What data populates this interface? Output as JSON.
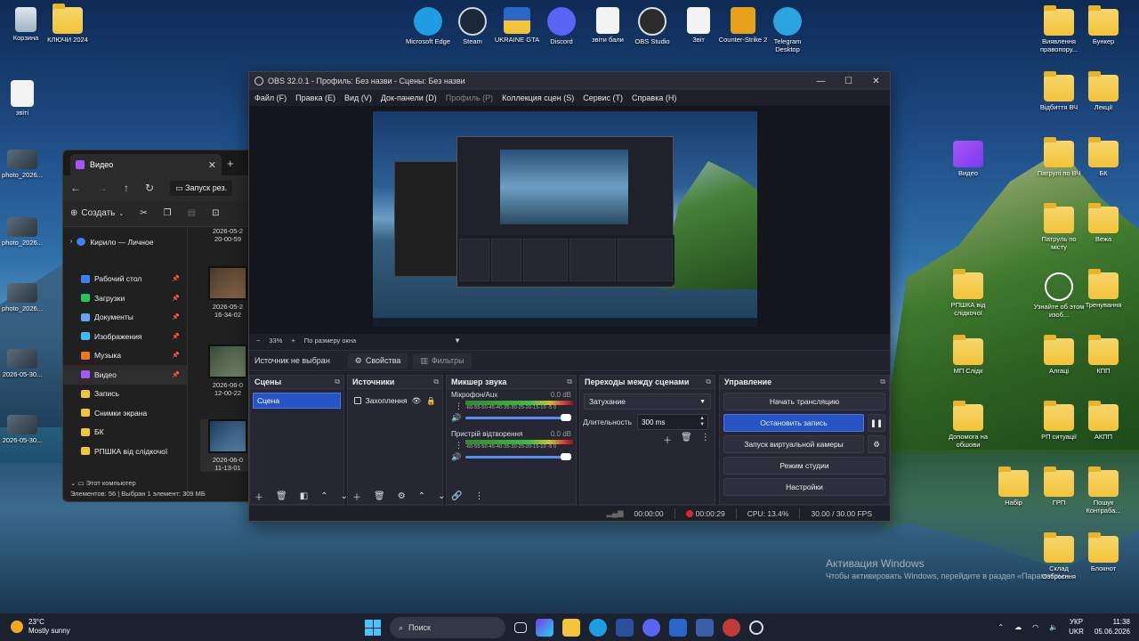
{
  "desktop": {
    "left_icons": [
      {
        "label": "Корзина",
        "icon": "recycle-bin-icon"
      },
      {
        "label": "КЛЮЧИ 2024",
        "icon": "folder-icon"
      },
      {
        "label": "звіті",
        "icon": "document-icon"
      },
      {
        "label": "photo_2026...",
        "icon": "image-icon"
      },
      {
        "label": "photo_2026...",
        "icon": "image-icon"
      },
      {
        "label": "photo_2026...",
        "icon": "image-icon"
      },
      {
        "label": "2026-05-30...",
        "icon": "image-icon"
      },
      {
        "label": "2026-05-30...",
        "icon": "image-icon"
      }
    ],
    "top_icons": [
      {
        "label": "Microsoft Edge",
        "icon": "edge-icon",
        "color": "#1f9de3"
      },
      {
        "label": "Steam",
        "icon": "steam-icon",
        "color": "#1b2838"
      },
      {
        "label": "UKRAINE GTA",
        "icon": "ukraine-gta-icon",
        "color": "#2a66c8"
      },
      {
        "label": "Discord",
        "icon": "discord-icon",
        "color": "#5865f2"
      },
      {
        "label": "звіти бали",
        "icon": "document-icon",
        "color": "#f3f3f3"
      },
      {
        "label": "OBS Studio",
        "icon": "obs-icon",
        "color": "#2b2b2b"
      },
      {
        "label": "Звіт",
        "icon": "document-icon",
        "color": "#f3f3f3"
      },
      {
        "label": "Counter-Strike 2",
        "icon": "counter-strike-icon",
        "color": "#e6a21c"
      },
      {
        "label": "Telegram Desktop",
        "icon": "telegram-icon",
        "color": "#2aa3df"
      }
    ],
    "right_icons": [
      {
        "label": "Виявлення правопору...",
        "icon": "folder-icon"
      },
      {
        "label": "Бункер",
        "icon": "folder-icon"
      },
      {
        "label": "Відбиття ВЧ",
        "icon": "folder-icon"
      },
      {
        "label": "Лекції",
        "icon": "folder-icon"
      },
      {
        "label": "Видео",
        "icon": "video-folder-icon"
      },
      {
        "label": "Патрулі по ВЧ",
        "icon": "folder-icon"
      },
      {
        "label": "БК",
        "icon": "folder-icon"
      },
      {
        "label": "Патруль по місту",
        "icon": "folder-icon"
      },
      {
        "label": "Вежа",
        "icon": "folder-icon"
      },
      {
        "label": "РПШКА від слідкочої",
        "icon": "folder-icon"
      },
      {
        "label": "Узнайте об этом изоб...",
        "icon": "info-icon"
      },
      {
        "label": "Тренування",
        "icon": "folder-icon"
      },
      {
        "label": "МП Слідк",
        "icon": "folder-icon"
      },
      {
        "label": "Алгаці",
        "icon": "folder-icon"
      },
      {
        "label": "КПП",
        "icon": "folder-icon"
      },
      {
        "label": "Допомога на обшови",
        "icon": "folder-icon"
      },
      {
        "label": "РП ситуації",
        "icon": "folder-icon"
      },
      {
        "label": "АКПП",
        "icon": "folder-icon"
      },
      {
        "label": "Набір",
        "icon": "folder-icon"
      },
      {
        "label": "ГРП",
        "icon": "folder-icon"
      },
      {
        "label": "Пошук Контраба...",
        "icon": "folder-icon"
      },
      {
        "label": "Склад Озброєння",
        "icon": "folder-icon"
      },
      {
        "label": "Блокнот",
        "icon": "folder-icon"
      }
    ],
    "activation": {
      "line1": "Активация Windows",
      "line2": "Чтобы активировать Windows, перейдите в раздел «Параметры»."
    }
  },
  "explorer": {
    "tab_title": "Видео",
    "address": "Запуск рез.",
    "new_button": "Создать",
    "account": "Кирило — Личное",
    "sidebar": [
      {
        "label": "Рабочий стол",
        "color": "#3b82f6",
        "pinned": true
      },
      {
        "label": "Загрузки",
        "color": "#22c55e",
        "pinned": true
      },
      {
        "label": "Документы",
        "color": "#60a5fa",
        "pinned": true
      },
      {
        "label": "Изображения",
        "color": "#38bdf8",
        "pinned": true
      },
      {
        "label": "Музыка",
        "color": "#f97316",
        "pinned": true
      },
      {
        "label": "Видео",
        "color": "#a855f7",
        "pinned": true
      },
      {
        "label": "Запись",
        "color": "#f3c33b",
        "pinned": false
      },
      {
        "label": "Снимки экрана",
        "color": "#f3c33b",
        "pinned": false
      },
      {
        "label": "БК",
        "color": "#f3c33b",
        "pinned": false
      },
      {
        "label": "РПШКА від слідкочої",
        "color": "#f3c33b",
        "pinned": false
      }
    ],
    "files": [
      {
        "date": "2026-05-2",
        "time": "20-00-59"
      },
      {
        "date": "2026-05-2",
        "time": "16-34-02"
      },
      {
        "date": "2026-06-0",
        "time": "12-00-22"
      },
      {
        "date": "2026-06-0",
        "time": "11-13-01"
      }
    ],
    "this_pc": "Этот компьютер",
    "status": "Элементов: 56 | Выбран 1 элемент: 309 МБ"
  },
  "obs": {
    "title": "OBS 32.0.1 - Профиль: Без назви - Сцены: Без назви",
    "menu": [
      {
        "label": "Файл (F)",
        "enabled": true
      },
      {
        "label": "Правка (E)",
        "enabled": true
      },
      {
        "label": "Вид (V)",
        "enabled": true
      },
      {
        "label": "Док-панели (D)",
        "enabled": true
      },
      {
        "label": "Профиль (P)",
        "enabled": false
      },
      {
        "label": "Коллекция сцен (S)",
        "enabled": true
      },
      {
        "label": "Сервис (T)",
        "enabled": true
      },
      {
        "label": "Справка (H)",
        "enabled": true
      }
    ],
    "zoom": {
      "minus": "−",
      "value": "33%",
      "plus": "+",
      "mode": "По размеру окна"
    },
    "source_bar": {
      "status": "Источник не выбран",
      "properties": "Свойства",
      "filters": "Фильтры"
    },
    "docks": {
      "scenes": {
        "title": "Сцены",
        "items": [
          "Сцена"
        ]
      },
      "sources": {
        "title": "Источники",
        "items": [
          "Захоплення"
        ]
      },
      "mixer": {
        "title": "Микшер звука",
        "channels": [
          {
            "name": "Мікрофон/Aux",
            "db": "0.0 dB",
            "level": 0.9
          },
          {
            "name": "Пристрій відтворення",
            "db": "0.0 dB",
            "level": 0.95
          }
        ],
        "ticks": "-60-55-50-45-40-35-30-25-20-15-10 -5 0"
      },
      "transitions": {
        "title": "Переходы между сценами",
        "selected": "Затухание",
        "duration_label": "Длительность",
        "duration_value": "300 ms"
      },
      "controls": {
        "title": "Управление",
        "buttons": [
          "Начать трансляцию",
          "Остановить запись",
          "Запуск виртуальной камеры",
          "Режим студии",
          "Настройки"
        ]
      }
    },
    "status": {
      "stream_time": "00:00:00",
      "rec_time": "00:00:29",
      "cpu": "CPU: 13.4%",
      "fps": "30.00 / 30.00 FPS"
    }
  },
  "taskbar": {
    "weather_temp": "23°C",
    "weather_desc": "Mostly sunny",
    "search": "Поиск",
    "lang1": "УКР",
    "lang2": "UKR",
    "time": "11:38",
    "date": "05.06.2026"
  }
}
